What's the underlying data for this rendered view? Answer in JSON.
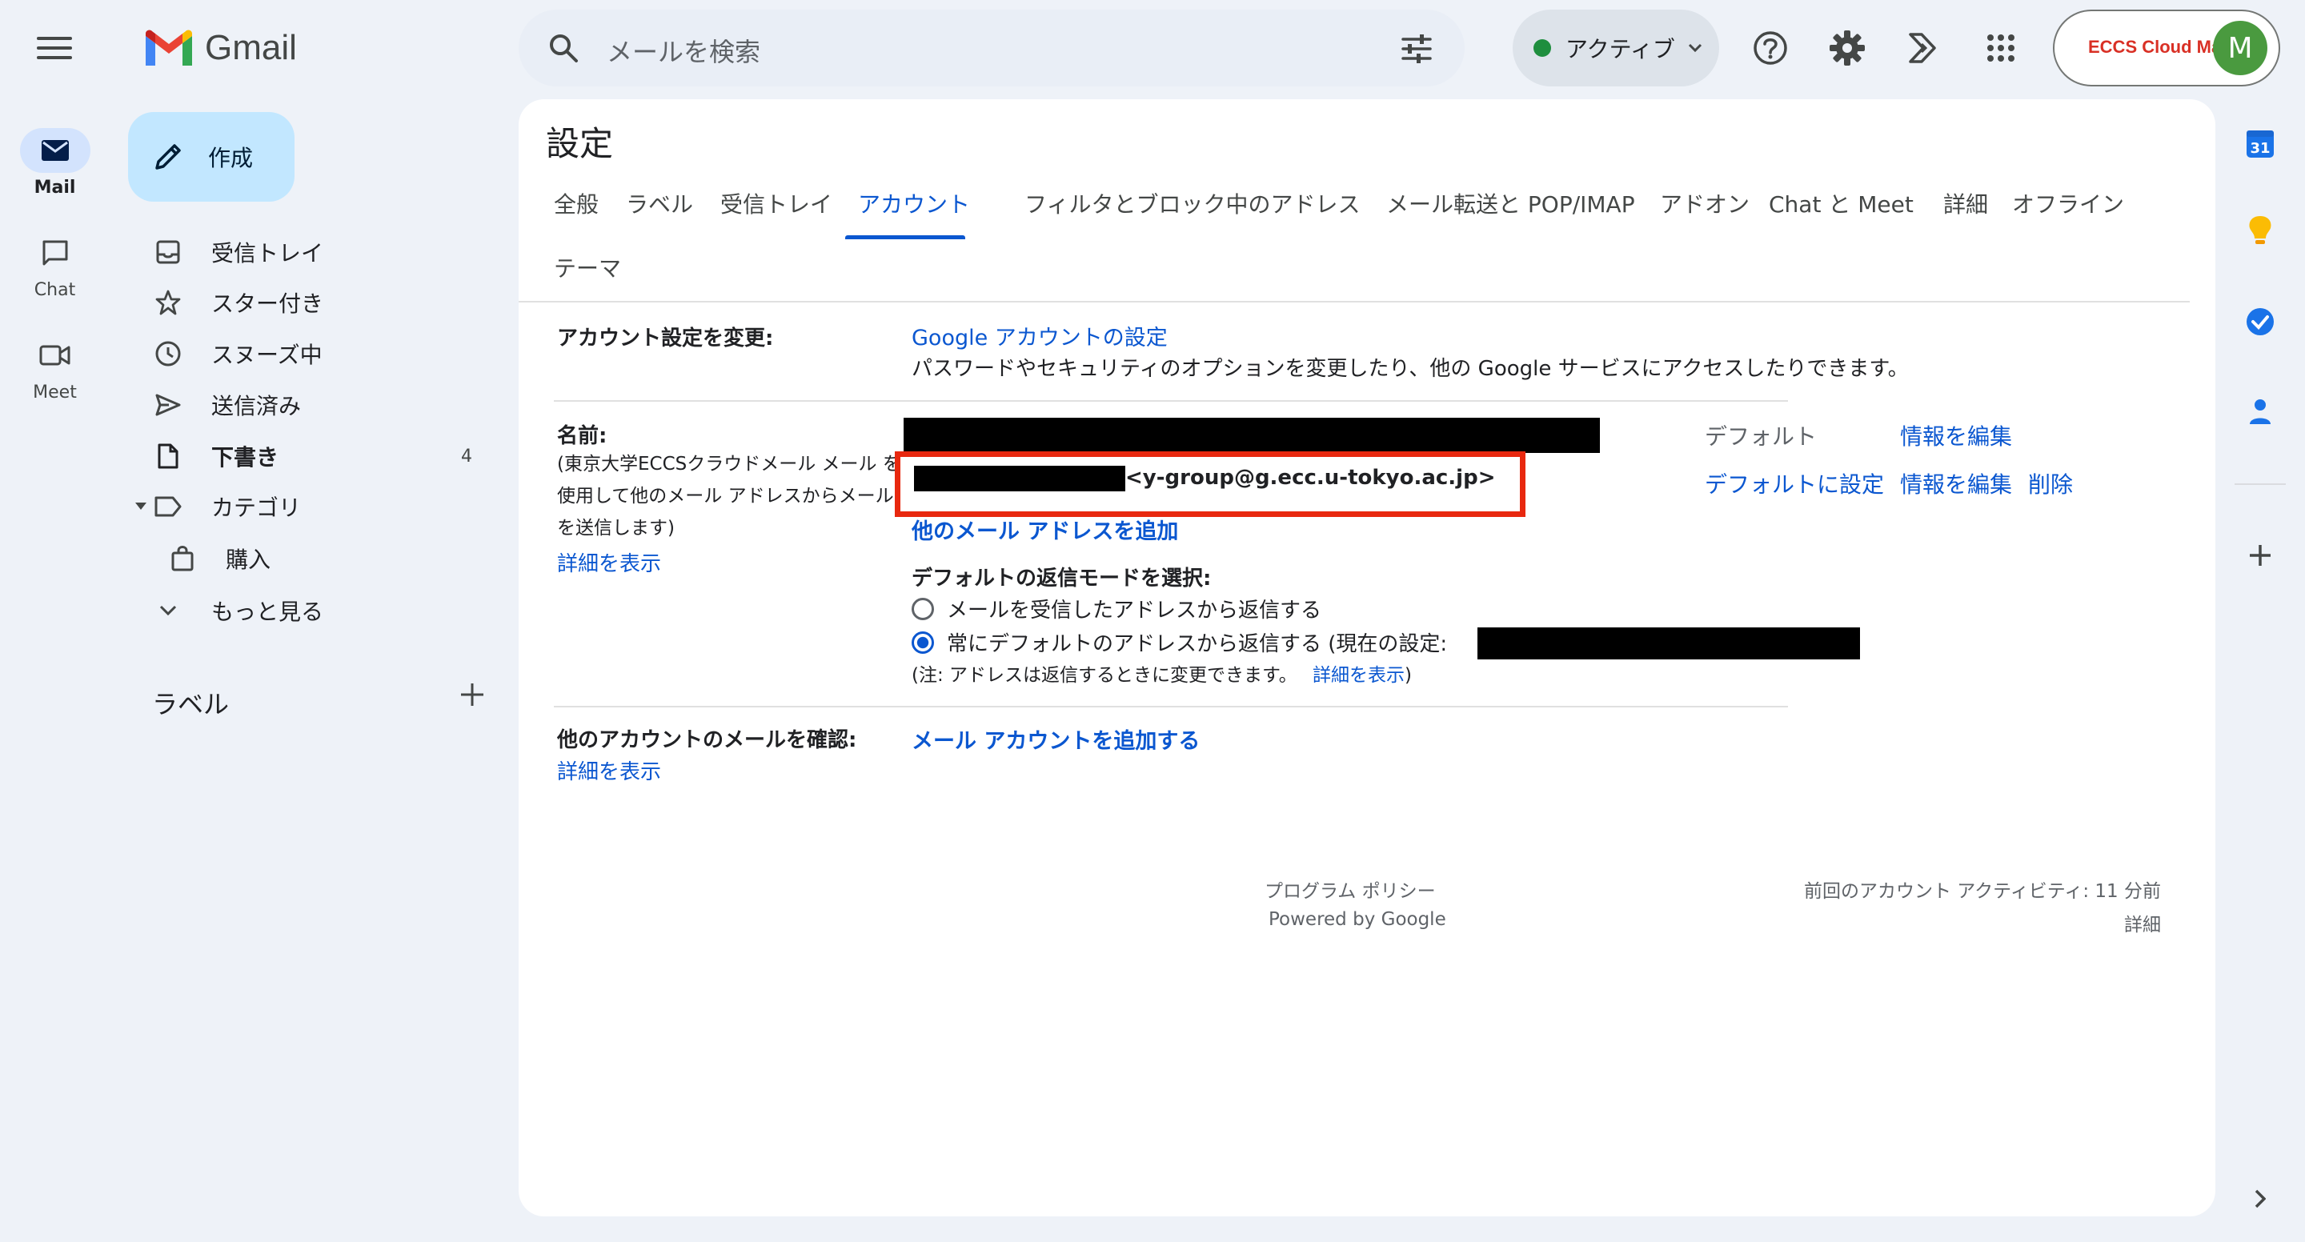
{
  "app": {
    "name": "Gmail"
  },
  "rail": [
    {
      "label": "Mail",
      "active": true
    },
    {
      "label": "Chat",
      "active": false
    },
    {
      "label": "Meet",
      "active": false
    }
  ],
  "search": {
    "placeholder": "メールを検索"
  },
  "status": {
    "label": "アクティブ",
    "color": "#1e8e3e"
  },
  "account": {
    "org_logo_text": "ECCS Cloud Mail",
    "avatar_initial": "M",
    "avatar_color": "#4a9a3f"
  },
  "compose": {
    "label": "作成"
  },
  "nav": [
    {
      "label": "受信トレイ",
      "icon": "inbox-icon",
      "count": ""
    },
    {
      "label": "スター付き",
      "icon": "star-icon",
      "count": ""
    },
    {
      "label": "スヌーズ中",
      "icon": "clock-icon",
      "count": ""
    },
    {
      "label": "送信済み",
      "icon": "send-icon",
      "count": ""
    },
    {
      "label": "下書き",
      "icon": "draft-icon",
      "count": "4",
      "bold": true
    },
    {
      "label": "カテゴリ",
      "icon": "label-icon",
      "count": ""
    },
    {
      "label": "購入",
      "icon": "shopping-bag-icon",
      "count": ""
    },
    {
      "label": "もっと見る",
      "icon": "chevron-down-icon",
      "count": ""
    }
  ],
  "labels_section": {
    "heading": "ラベル"
  },
  "settings": {
    "title": "設定",
    "tabs": [
      "全般",
      "ラベル",
      "受信トレイ",
      "アカウント",
      "フィルタとブロック中のアドレス",
      "メール転送と POP/IMAP",
      "アドオン",
      "Chat と Meet",
      "詳細",
      "オフライン",
      "テーマ"
    ],
    "active_tab": "アカウント",
    "account_change": {
      "label": "アカウント設定を変更:",
      "link": "Google アカウントの設定",
      "description": "パスワードやセキュリティのオプションを変更したり、他の Google サービスにアクセスしたりできます。"
    },
    "send_as": {
      "label": "名前:",
      "desc_line1": "(東京大学ECCSクラウドメール メール を",
      "desc_line2": "使用して他のメール アドレスからメール",
      "desc_line3": "を送信します)",
      "details_link": "詳細を表示",
      "address_suffix": "<y-group@g.ecc.u-tokyo.ac.jp>",
      "default_label": "デフォルト",
      "edit_info": "情報を編集",
      "make_default": "デフォルトに設定",
      "edit_info_2": "情報を編集",
      "delete": "削除",
      "add_address": "他のメール アドレスを追加",
      "reply_mode_heading": "デフォルトの返信モードを選択:",
      "reply_option_1": "メールを受信したアドレスから返信する",
      "reply_option_2": "常にデフォルトのアドレスから返信する (現在の設定:",
      "note_prefix": "(注: アドレスは返信するときに変更できます。",
      "note_link": "詳細を表示",
      "note_suffix": ")"
    },
    "check_mail": {
      "label": "他のアカウントのメールを確認:",
      "link": "メール アカウントを追加する",
      "details_link": "詳細を表示"
    },
    "footer": {
      "program_policy": "プログラム ポリシー",
      "powered_by": "Powered by Google",
      "last_activity": "前回のアカウント アクティビティ: 11 分前",
      "details": "詳細"
    }
  },
  "side_apps": [
    {
      "name": "calendar-icon",
      "badge": "31"
    },
    {
      "name": "keep-icon"
    },
    {
      "name": "tasks-icon"
    },
    {
      "name": "contacts-icon"
    }
  ]
}
